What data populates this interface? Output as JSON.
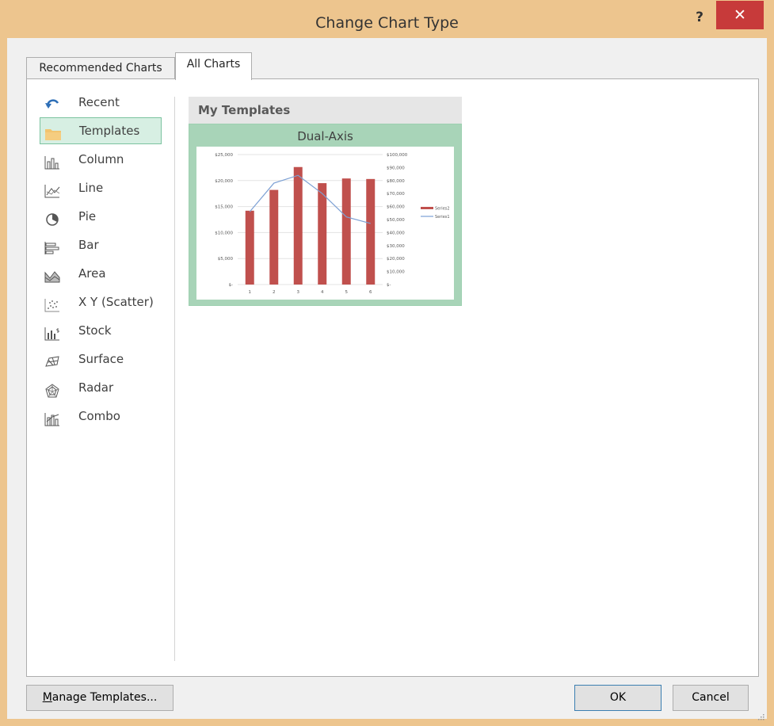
{
  "window": {
    "title": "Change Chart Type",
    "help_label": "?",
    "close_label": "✕"
  },
  "tabs": [
    {
      "label": "Recommended Charts",
      "selected": false
    },
    {
      "label": "All Charts",
      "selected": true
    }
  ],
  "sidebar": {
    "items": [
      {
        "label": "Recent",
        "icon": "undo-arrow-icon"
      },
      {
        "label": "Templates",
        "icon": "folder-icon",
        "selected": true
      },
      {
        "label": "Column",
        "icon": "column-chart-icon"
      },
      {
        "label": "Line",
        "icon": "line-chart-icon"
      },
      {
        "label": "Pie",
        "icon": "pie-chart-icon"
      },
      {
        "label": "Bar",
        "icon": "bar-chart-icon"
      },
      {
        "label": "Area",
        "icon": "area-chart-icon"
      },
      {
        "label": "X Y (Scatter)",
        "icon": "scatter-chart-icon"
      },
      {
        "label": "Stock",
        "icon": "stock-chart-icon"
      },
      {
        "label": "Surface",
        "icon": "surface-chart-icon"
      },
      {
        "label": "Radar",
        "icon": "radar-chart-icon"
      },
      {
        "label": "Combo",
        "icon": "combo-chart-icon"
      }
    ]
  },
  "main": {
    "section_title": "My Templates",
    "template": {
      "name": "Dual-Axis"
    }
  },
  "chart_data": {
    "type": "bar",
    "title": "",
    "categories": [
      "1",
      "2",
      "3",
      "4",
      "5",
      "6"
    ],
    "left_axis": {
      "ticks": [
        "$25,000",
        "$20,000",
        "$15,000",
        "$10,000",
        "$5,000",
        "$-"
      ],
      "ylim": [
        0,
        25000
      ]
    },
    "right_axis": {
      "ticks": [
        "$100,000",
        "$90,000",
        "$80,000",
        "$70,000",
        "$60,000",
        "$50,000",
        "$40,000",
        "$30,000",
        "$20,000",
        "$10,000",
        "$-"
      ],
      "ylim": [
        0,
        100000
      ]
    },
    "series": [
      {
        "name": "Series2",
        "type": "bar",
        "axis": "left",
        "color": "#c0504d",
        "values": [
          14200,
          18200,
          22600,
          19500,
          20400,
          20300
        ]
      },
      {
        "name": "Series1",
        "type": "line",
        "axis": "right",
        "color": "#7ca0d4",
        "values": [
          56000,
          78000,
          84000,
          70000,
          52000,
          47000
        ]
      }
    ],
    "legend": "right"
  },
  "buttons": {
    "manage_templates": "Manage Templates...",
    "manage_templates_mnemonic": "M",
    "manage_templates_rest": "anage Templates...",
    "ok": "OK",
    "cancel": "Cancel"
  },
  "colors": {
    "frame": "#edc58e",
    "close": "#c73a3a",
    "selected_bg": "#d7efe3",
    "template_border": "#a8d4b8"
  }
}
